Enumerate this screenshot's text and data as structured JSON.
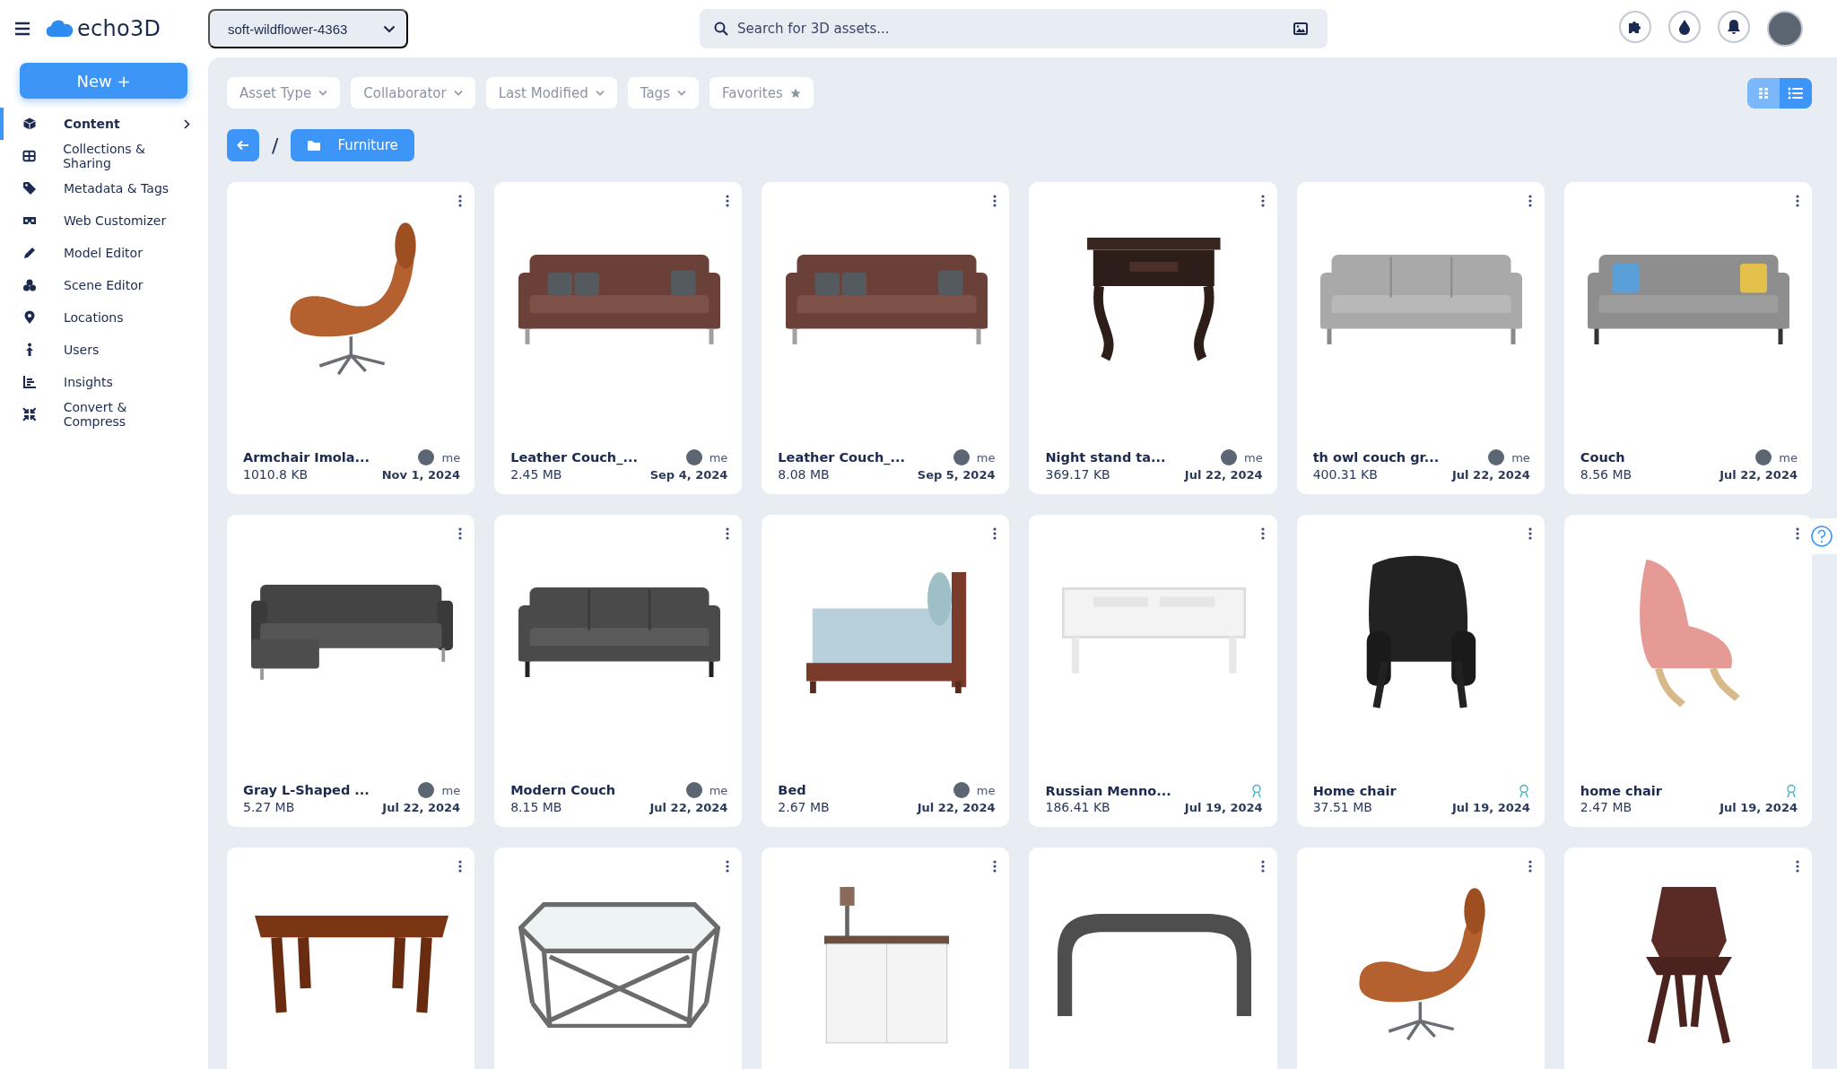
{
  "topbar": {
    "brand": "echo3D",
    "project": "soft-wildflower-4363",
    "search": {
      "placeholder": "Search for 3D assets..."
    }
  },
  "sidebar": {
    "new_button": "New +",
    "items": [
      {
        "label": "Content",
        "selected": true
      },
      {
        "label": "Collections & Sharing",
        "selected": false
      },
      {
        "label": "Metadata & Tags",
        "selected": false
      },
      {
        "label": "Web Customizer",
        "selected": false
      },
      {
        "label": "Model Editor",
        "selected": false
      },
      {
        "label": "Scene Editor",
        "selected": false
      },
      {
        "label": "Locations",
        "selected": false
      },
      {
        "label": "Users",
        "selected": false
      },
      {
        "label": "Insights",
        "selected": false
      },
      {
        "label": "Convert & Compress",
        "selected": false
      }
    ]
  },
  "filters": [
    {
      "label": "Asset Type",
      "kind": "dropdown"
    },
    {
      "label": "Collaborator",
      "kind": "dropdown"
    },
    {
      "label": "Last Modified",
      "kind": "dropdown"
    },
    {
      "label": "Tags",
      "kind": "dropdown"
    },
    {
      "label": "Favorites",
      "kind": "star"
    }
  ],
  "view_toggle": [
    {
      "kind": "grid",
      "selected": false
    },
    {
      "kind": "list",
      "selected": true
    }
  ],
  "breadcrumb": {
    "separator": "/",
    "folder": "Furniture"
  },
  "assets": [
    {
      "kind": "lounge-chair",
      "name": "Armchair Imola...",
      "owner": "me",
      "size": "1010.8 KB",
      "date": "Nov 1, 2024"
    },
    {
      "kind": "leather-sofa",
      "name": "Leather Couch_...",
      "owner": "me",
      "size": "2.45 MB",
      "date": "Sep 4, 2024"
    },
    {
      "kind": "leather-sofa",
      "name": "Leather Couch_...",
      "owner": "me",
      "size": "8.08 MB",
      "date": "Sep 5, 2024"
    },
    {
      "kind": "nightstand",
      "name": "Night stand ta...",
      "owner": "me",
      "size": "369.17 KB",
      "date": "Jul 22, 2024"
    },
    {
      "kind": "fabric-sofa",
      "name": "th owl couch gr...",
      "owner": "me",
      "size": "400.31 KB",
      "date": "Jul 22, 2024"
    },
    {
      "kind": "patterned-sofa",
      "name": "Couch",
      "owner": "me",
      "size": "8.56 MB",
      "date": "Jul 22, 2024"
    },
    {
      "kind": "sectional-sofa",
      "name": "Gray L-Shaped ...",
      "owner": "me",
      "size": "5.27 MB",
      "date": "Jul 22, 2024"
    },
    {
      "kind": "sofa",
      "name": "Modern Couch",
      "owner": "me",
      "size": "8.15 MB",
      "date": "Jul 22, 2024"
    },
    {
      "kind": "bed",
      "name": "Bed",
      "owner": "me",
      "size": "2.67 MB",
      "date": "Jul 22, 2024"
    },
    {
      "kind": "bench",
      "name": "Russian Menno...",
      "size": "186.41 KB",
      "date": "Jul 19, 2024"
    },
    {
      "kind": "tufted-chair",
      "name": "Home chair",
      "size": "37.51 MB",
      "date": "Jul 19, 2024"
    },
    {
      "kind": "floral-chair",
      "name": "home chair",
      "size": "2.47 MB",
      "date": "Jul 19, 2024"
    },
    {
      "kind": "table"
    },
    {
      "kind": "glass-table"
    },
    {
      "kind": "cabinet"
    },
    {
      "kind": "console-table"
    },
    {
      "kind": "lounge-chair"
    },
    {
      "kind": "shell-chair"
    }
  ]
}
